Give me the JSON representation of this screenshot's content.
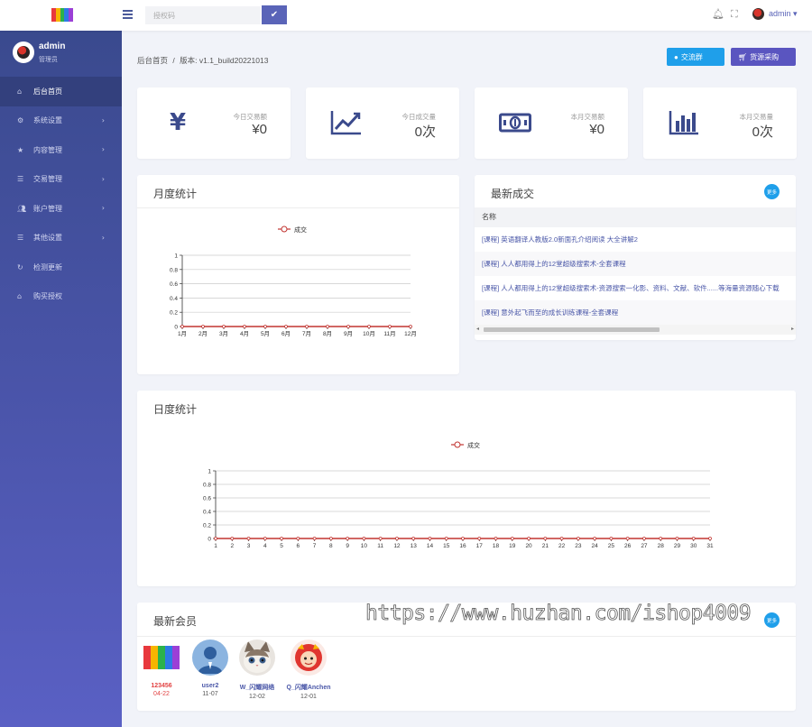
{
  "topbar": {
    "search_placeholder": "授权码",
    "confirm_icon": "check-icon",
    "user_label": "admin",
    "logo_colors": [
      "#e8383d",
      "#f7b500",
      "#2bb24c",
      "#2d7be5",
      "#9b3fd6"
    ]
  },
  "sidebar": {
    "user_name": "admin",
    "user_role": "管理员",
    "items": [
      {
        "label": "后台首页",
        "icon": "home-icon",
        "active": true,
        "arrow": false
      },
      {
        "label": "系统设置",
        "icon": "gear-icon",
        "active": false,
        "arrow": true
      },
      {
        "label": "内容管理",
        "icon": "star-icon",
        "active": false,
        "arrow": true
      },
      {
        "label": "交易管理",
        "icon": "list-icon",
        "active": false,
        "arrow": true
      },
      {
        "label": "账户管理",
        "icon": "users-icon",
        "active": false,
        "arrow": true
      },
      {
        "label": "其他设置",
        "icon": "list-icon",
        "active": false,
        "arrow": true
      },
      {
        "label": "检测更新",
        "icon": "refresh-icon",
        "active": false,
        "arrow": false
      },
      {
        "label": "购买授权",
        "icon": "home-icon",
        "active": false,
        "arrow": false
      }
    ]
  },
  "breadcrumb": {
    "home": "后台首页",
    "separator": "/",
    "version": "版本: v1.1_build20221013"
  },
  "buttons": {
    "group_label": "交流群",
    "buy_label": "货源采购"
  },
  "stats": [
    {
      "label": "今日交易额",
      "value": "¥0",
      "icon": "yen-icon"
    },
    {
      "label": "今日成交量",
      "value": "0次",
      "icon": "trend-chart-icon"
    },
    {
      "label": "本月交易额",
      "value": "¥0",
      "icon": "money-icon"
    },
    {
      "label": "本月交易量",
      "value": "0次",
      "icon": "bar-chart-icon"
    }
  ],
  "monthly_panel": {
    "title": "月度统计"
  },
  "daily_panel": {
    "title": "日度统计"
  },
  "deals": {
    "title": "最新成交",
    "more_label": "更多",
    "column": "名称",
    "rows": [
      "[课程] 英语翻译人教版2.0新面孔介绍阅读 大全讲解2",
      "[课程] 人人都用得上的12堂超级搜索术-全套课程",
      "[课程] 人人都用得上的12堂超级搜索术-资源搜索一化影、资料、文献、软件......等海量资源随心下载",
      "[课程] 意外起飞而至的成长训练课程-全套课程"
    ]
  },
  "members": {
    "title": "最新会员",
    "more_label": "更多",
    "list": [
      {
        "name": "123456",
        "date": "04-22",
        "highlight": true
      },
      {
        "name": "user2",
        "date": "11-07",
        "highlight": false
      },
      {
        "name": "W_闪耀网络",
        "date": "12-02",
        "highlight": false
      },
      {
        "name": "Q_闪耀Anchen",
        "date": "12-01",
        "highlight": false
      }
    ]
  },
  "watermark": "https://www.huzhan.com/ishop4009",
  "chart_data": [
    {
      "type": "line",
      "title": "月度统计",
      "legend": [
        "成交"
      ],
      "legend_position": "top-center",
      "categories": [
        "1月",
        "2月",
        "3月",
        "4月",
        "5月",
        "6月",
        "7月",
        "8月",
        "9月",
        "10月",
        "11月",
        "12月"
      ],
      "series": [
        {
          "name": "成交",
          "values": [
            0,
            0,
            0,
            0,
            0,
            0,
            0,
            0,
            0,
            0,
            0,
            0
          ],
          "color": "#c23531"
        }
      ],
      "y_ticks": [
        "0",
        "0.2",
        "0.4",
        "0.6",
        "0.8",
        "1"
      ],
      "ylim": [
        0,
        1
      ],
      "grid": true
    },
    {
      "type": "line",
      "title": "日度统计",
      "legend": [
        "成交"
      ],
      "legend_position": "top-center",
      "categories": [
        "1",
        "2",
        "3",
        "4",
        "5",
        "6",
        "7",
        "8",
        "9",
        "10",
        "11",
        "12",
        "13",
        "14",
        "15",
        "16",
        "17",
        "18",
        "19",
        "20",
        "21",
        "22",
        "23",
        "24",
        "25",
        "26",
        "27",
        "28",
        "29",
        "30",
        "31"
      ],
      "series": [
        {
          "name": "成交",
          "values": [
            0,
            0,
            0,
            0,
            0,
            0,
            0,
            0,
            0,
            0,
            0,
            0,
            0,
            0,
            0,
            0,
            0,
            0,
            0,
            0,
            0,
            0,
            0,
            0,
            0,
            0,
            0,
            0,
            0,
            0,
            0
          ],
          "color": "#c23531"
        }
      ],
      "y_ticks": [
        "0",
        "0.2",
        "0.4",
        "0.6",
        "0.8",
        "1"
      ],
      "ylim": [
        0,
        1
      ],
      "grid": true
    }
  ]
}
